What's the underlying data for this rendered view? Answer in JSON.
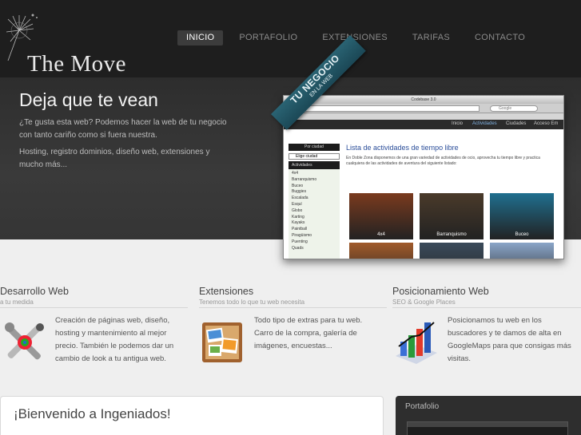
{
  "brand": {
    "name": "The Move"
  },
  "nav": {
    "items": [
      "INICIO",
      "PORTAFOLIO",
      "EXTENSIONES",
      "TARIFAS",
      "CONTACTO"
    ]
  },
  "hero": {
    "title": "Deja que te vean",
    "p1": "¿Te gusta esta web? Podemos hacer la web de tu negocio con tanto cariño como si fuera nuestra.",
    "p2": "Hosting, registro dominios, diseño web, extensiones y mucho más...",
    "ribbon_line1": "TU NEGOCIO",
    "ribbon_line2": "EN LA WEB",
    "screenshot": {
      "window_title": "Codebase 3.0",
      "search_placeholder": "Google",
      "nav": [
        "Inicio",
        "Actividades",
        "Ciudades",
        "Acceso Em"
      ],
      "city_label": "Por ciudad",
      "select_label": "Elige ciudad",
      "activities_label": "Actividades",
      "activities": [
        "4x4",
        "Barranquismo",
        "Buceo",
        "Buggies",
        "Escalada",
        "Esquí",
        "Globo",
        "Karting",
        "Kayaks",
        "Paintball",
        "Piragüismo",
        "Puenting",
        "Quads"
      ],
      "heading": "Lista de actividades de tiempo libre",
      "text": "En Doble Zona disponemos de una gran variedad de actividades de ocio, aprovecha tu tiempo libre y practica cualquiera de las actividades de aventura del siguiente listado:",
      "thumbs": [
        {
          "caption": "4x4",
          "color": "#7a3a1e"
        },
        {
          "caption": "Barranquismo",
          "color": "#4a3a2a"
        },
        {
          "caption": "Buceo",
          "color": "#1f6f8f"
        },
        {
          "caption": "",
          "color": "#a05a2a"
        },
        {
          "caption": "",
          "color": "#3a4a5a"
        },
        {
          "caption": "",
          "color": "#8aa5c8"
        }
      ]
    }
  },
  "features": [
    {
      "title": "Desarrollo Web",
      "subtitle": "a tu medida",
      "text": "Creación de páginas web, diseño, hosting y mantenimiento al mejor precio. También le podemos dar un cambio de look a tu antigua web.",
      "icon": "tools-icon"
    },
    {
      "title": "Extensiones",
      "subtitle": "Tenemos todo lo que tu web necesita",
      "text": "Todo tipo de extras para tu web. Carro de la compra, galería de imágenes, encuestas...",
      "icon": "gallery-board-icon"
    },
    {
      "title": "Posicionamiento Web",
      "subtitle": "SEO & Google Places",
      "text": "Posicionamos tu web en los buscadores y te damos de alta en GoogleMaps para que consigas más visitas.",
      "icon": "bar-chart-icon"
    }
  ],
  "welcome": {
    "title": "¡Bienvenido a Ingeniados!"
  },
  "portfolio": {
    "title": "Portafolio"
  },
  "colors": {
    "header_bg": "#1e1e1e",
    "ribbon": "#1b4856",
    "link_blue": "#2a4d99"
  }
}
